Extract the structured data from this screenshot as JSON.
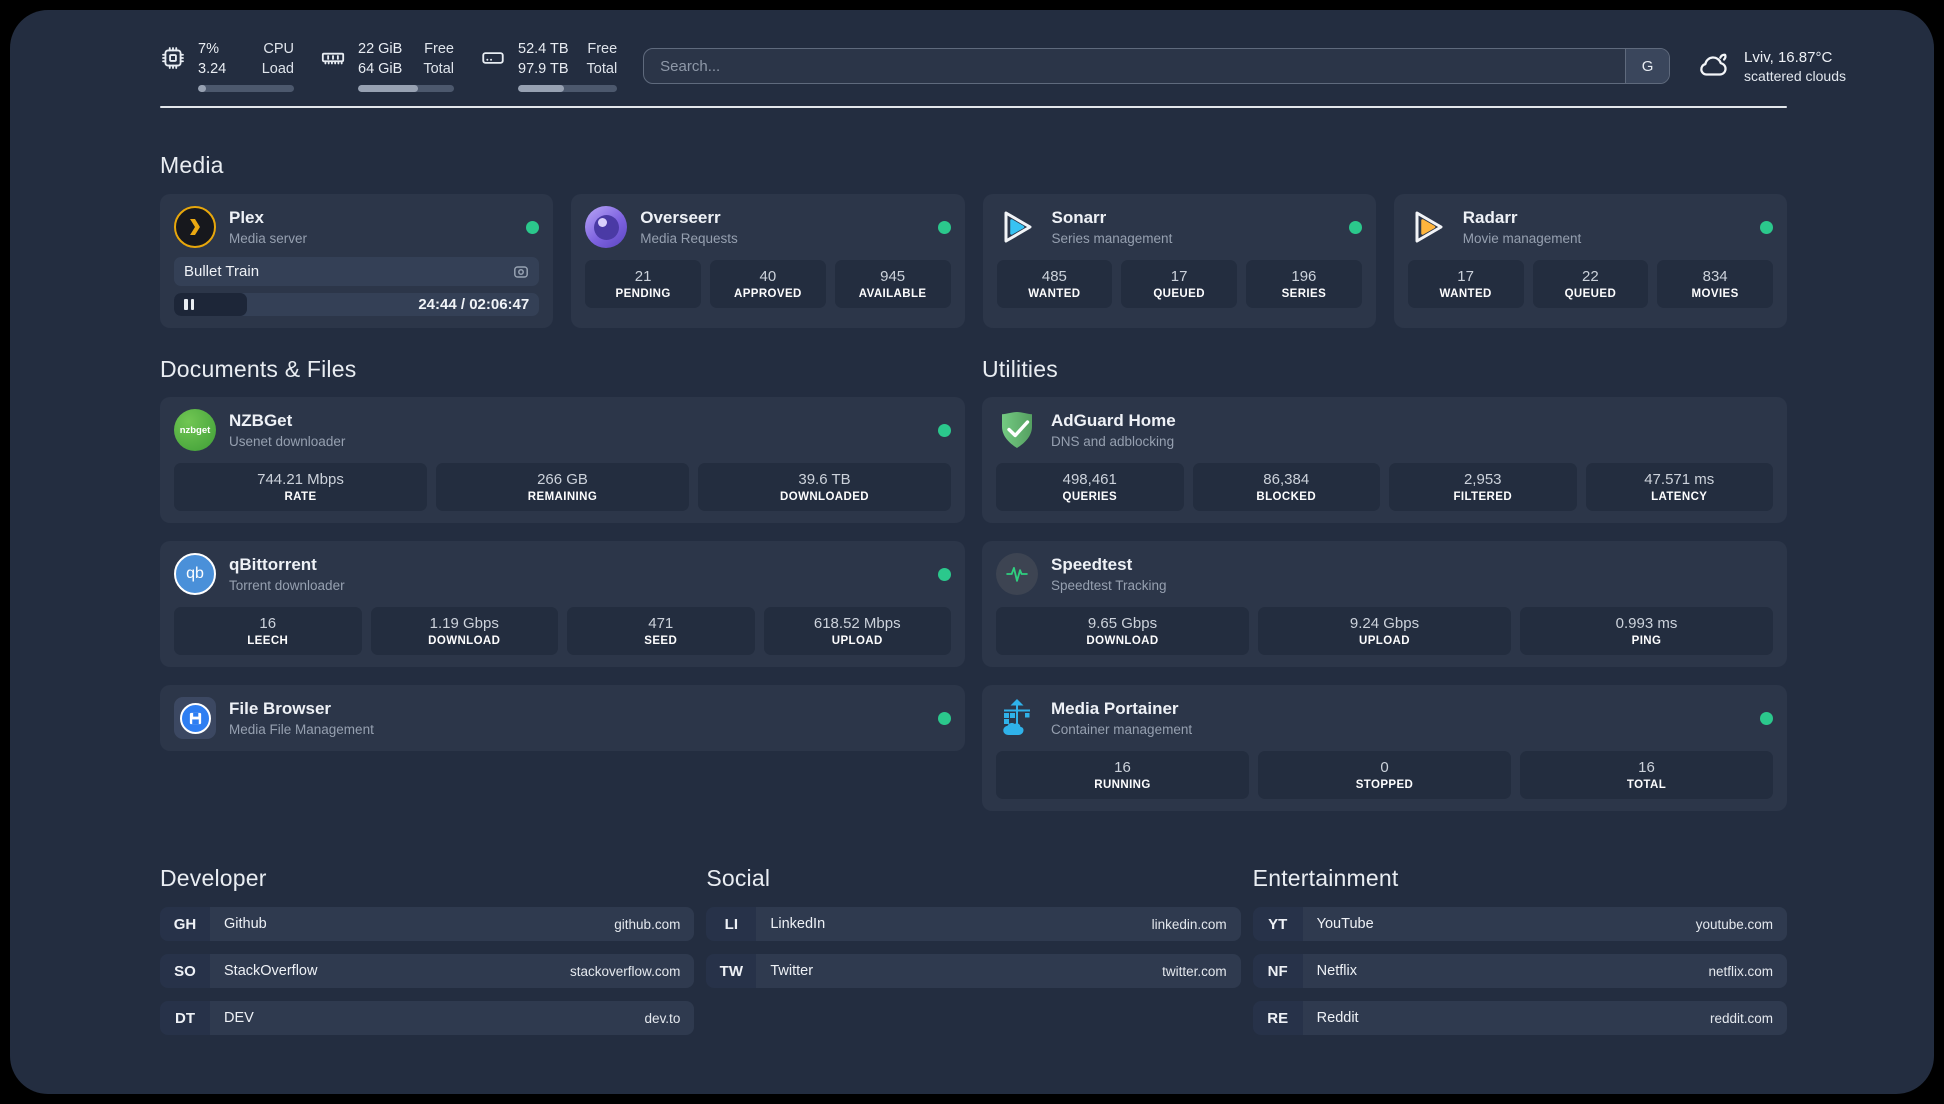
{
  "header": {
    "system_stats": [
      {
        "name": "cpu",
        "values": [
          "7%",
          "3.24"
        ],
        "labels": [
          "CPU",
          "Load"
        ],
        "progress_pct": 8
      },
      {
        "name": "memory",
        "values": [
          "22 GiB",
          "64 GiB"
        ],
        "labels": [
          "Free",
          "Total"
        ],
        "progress_pct": 62
      },
      {
        "name": "disk",
        "values": [
          "52.4 TB",
          "97.9 TB"
        ],
        "labels": [
          "Free",
          "Total"
        ],
        "progress_pct": 46
      }
    ],
    "search": {
      "placeholder": "Search...",
      "button": "G"
    },
    "weather": {
      "location": "Lviv, 16.87°C",
      "condition": "scattered clouds"
    }
  },
  "sections": {
    "media": {
      "title": "Media",
      "cards": [
        {
          "title": "Plex",
          "subtitle": "Media server",
          "status": "online",
          "now_playing": {
            "title": "Bullet Train",
            "time": "24:44 / 02:06:47",
            "state": "paused",
            "progress_pct": 20
          }
        },
        {
          "title": "Overseerr",
          "subtitle": "Media Requests",
          "status": "online",
          "stats": [
            {
              "value": "21",
              "label": "PENDING"
            },
            {
              "value": "40",
              "label": "APPROVED"
            },
            {
              "value": "945",
              "label": "AVAILABLE"
            }
          ]
        },
        {
          "title": "Sonarr",
          "subtitle": "Series management",
          "status": "online",
          "stats": [
            {
              "value": "485",
              "label": "WANTED"
            },
            {
              "value": "17",
              "label": "QUEUED"
            },
            {
              "value": "196",
              "label": "SERIES"
            }
          ]
        },
        {
          "title": "Radarr",
          "subtitle": "Movie management",
          "status": "online",
          "stats": [
            {
              "value": "17",
              "label": "WANTED"
            },
            {
              "value": "22",
              "label": "QUEUED"
            },
            {
              "value": "834",
              "label": "MOVIES"
            }
          ]
        }
      ]
    },
    "documents": {
      "title": "Documents & Files",
      "cards": [
        {
          "title": "NZBGet",
          "subtitle": "Usenet downloader",
          "status": "online",
          "icon_text": "nzbget",
          "stats": [
            {
              "value": "744.21 Mbps",
              "label": "RATE"
            },
            {
              "value": "266 GB",
              "label": "REMAINING"
            },
            {
              "value": "39.6 TB",
              "label": "DOWNLOADED"
            }
          ]
        },
        {
          "title": "qBittorrent",
          "subtitle": "Torrent downloader",
          "status": "online",
          "icon_text": "qb",
          "stats": [
            {
              "value": "16",
              "label": "LEECH"
            },
            {
              "value": "1.19 Gbps",
              "label": "DOWNLOAD"
            },
            {
              "value": "471",
              "label": "SEED"
            },
            {
              "value": "618.52 Mbps",
              "label": "UPLOAD"
            }
          ]
        },
        {
          "title": "File Browser",
          "subtitle": "Media File Management",
          "status": "online"
        }
      ]
    },
    "utilities": {
      "title": "Utilities",
      "cards": [
        {
          "title": "AdGuard Home",
          "subtitle": "DNS and adblocking",
          "stats": [
            {
              "value": "498,461",
              "label": "QUERIES"
            },
            {
              "value": "86,384",
              "label": "BLOCKED"
            },
            {
              "value": "2,953",
              "label": "FILTERED"
            },
            {
              "value": "47.571 ms",
              "label": "LATENCY"
            }
          ]
        },
        {
          "title": "Speedtest",
          "subtitle": "Speedtest Tracking",
          "stats": [
            {
              "value": "9.65 Gbps",
              "label": "DOWNLOAD"
            },
            {
              "value": "9.24 Gbps",
              "label": "UPLOAD"
            },
            {
              "value": "0.993 ms",
              "label": "PING"
            }
          ]
        },
        {
          "title": "Media Portainer",
          "subtitle": "Container management",
          "status": "online",
          "stats": [
            {
              "value": "16",
              "label": "RUNNING"
            },
            {
              "value": "0",
              "label": "STOPPED"
            },
            {
              "value": "16",
              "label": "TOTAL"
            }
          ]
        }
      ]
    },
    "developer": {
      "title": "Developer",
      "bookmarks": [
        {
          "abbr": "GH",
          "name": "Github",
          "url": "github.com"
        },
        {
          "abbr": "SO",
          "name": "StackOverflow",
          "url": "stackoverflow.com"
        },
        {
          "abbr": "DT",
          "name": "DEV",
          "url": "dev.to"
        }
      ]
    },
    "social": {
      "title": "Social",
      "bookmarks": [
        {
          "abbr": "LI",
          "name": "LinkedIn",
          "url": "linkedin.com"
        },
        {
          "abbr": "TW",
          "name": "Twitter",
          "url": "twitter.com"
        }
      ]
    },
    "entertainment": {
      "title": "Entertainment",
      "bookmarks": [
        {
          "abbr": "YT",
          "name": "YouTube",
          "url": "youtube.com"
        },
        {
          "abbr": "NF",
          "name": "Netflix",
          "url": "netflix.com"
        },
        {
          "abbr": "RE",
          "name": "Reddit",
          "url": "reddit.com"
        }
      ]
    }
  },
  "colors": {
    "status_online": "#2bc88c",
    "panel_bg": "#232d40",
    "card_bg": "#2c3649"
  }
}
